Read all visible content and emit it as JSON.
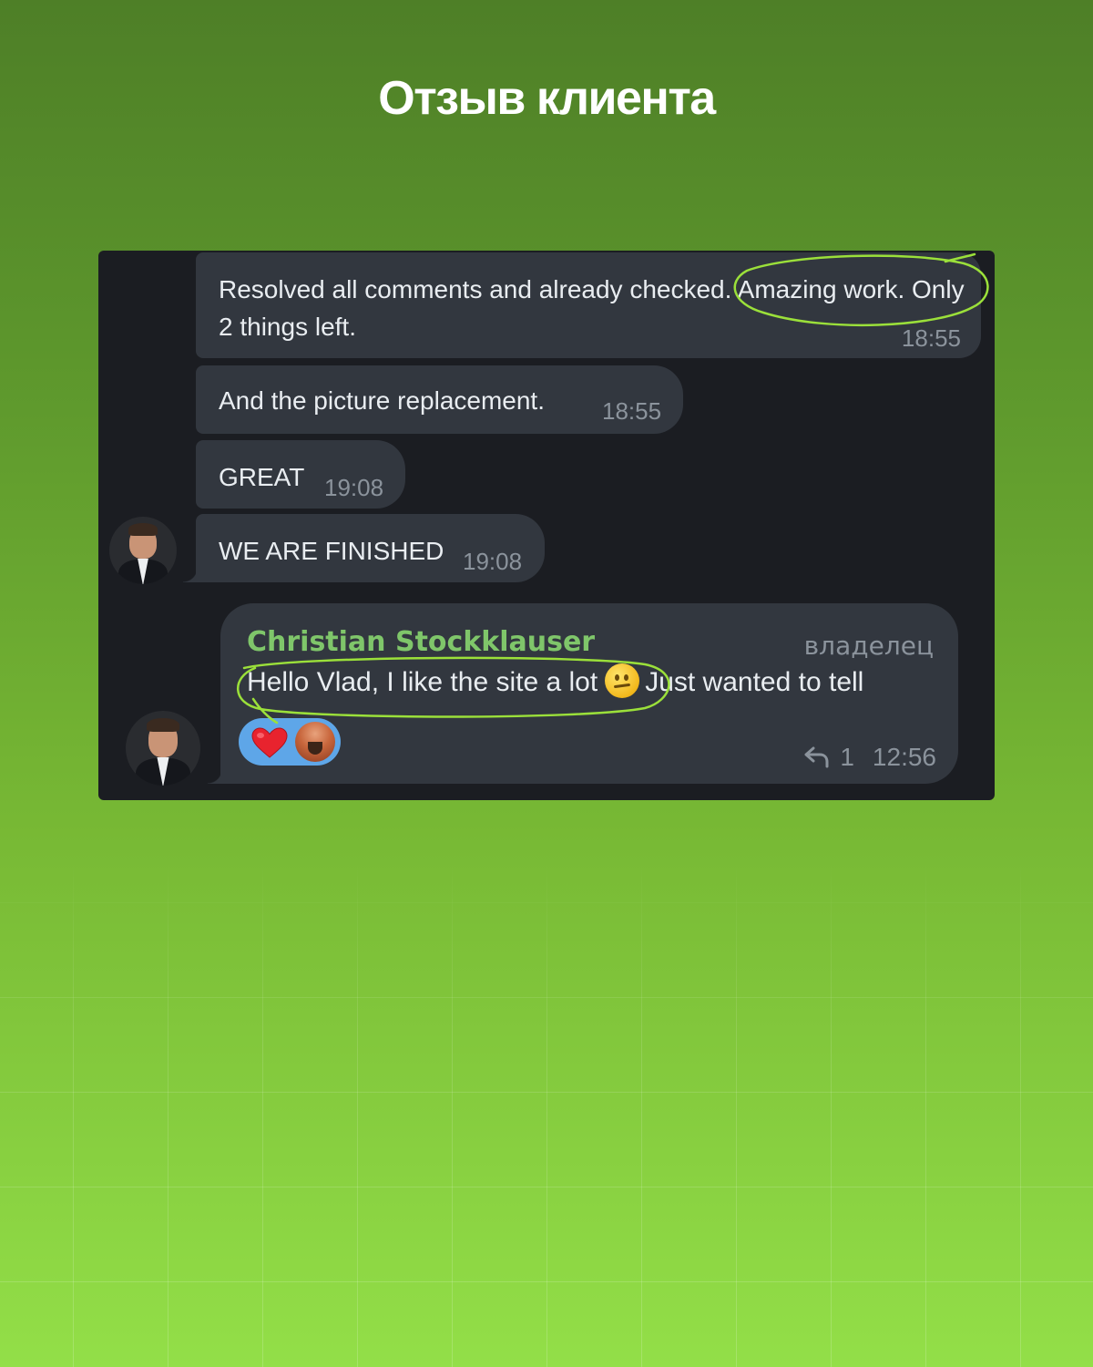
{
  "title": "Отзыв клиента",
  "messages": [
    {
      "text": "Resolved all comments and already checked. Amazing work. Only 2 things left.",
      "time": "18:55"
    },
    {
      "text": "And the picture replacement.",
      "time": "18:55"
    },
    {
      "text": "GREAT",
      "time": "19:08"
    },
    {
      "text": "WE ARE FINISHED",
      "time": "19:08"
    }
  ],
  "reply_message": {
    "sender": "Christian Stockklauser",
    "role": "владелец",
    "text_before_emoji": "Hello Vlad, I like the site a lot",
    "emoji": "slightly-smiling-face",
    "text_after_emoji": "Just wanted to tell",
    "reactions": [
      "heart",
      "user-avatar"
    ],
    "reply_count": "1",
    "time": "12:56"
  },
  "colors": {
    "background_top": "#4e7f27",
    "background_bottom": "#93df48",
    "chat_bg": "#1b1d22",
    "bubble_bg": "#32373f",
    "sender_name": "#7fc66a",
    "highlight_stroke": "#9be03a",
    "reaction_pill": "#5ea6e8"
  }
}
